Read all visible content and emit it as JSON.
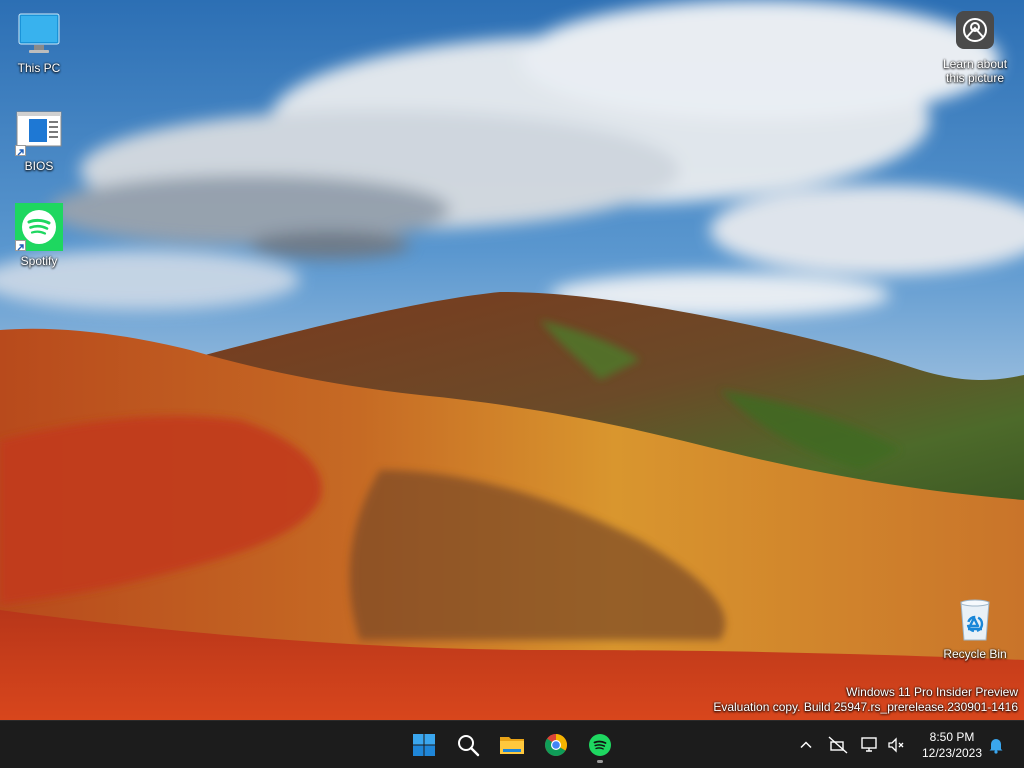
{
  "desktop": {
    "icons": [
      {
        "label": "This PC",
        "icon": "monitor-icon"
      },
      {
        "label": "BIOS",
        "icon": "bios-shortcut-icon"
      },
      {
        "label": "Spotify",
        "icon": "spotify-icon"
      },
      {
        "label": "Learn about\nthis picture",
        "icon": "camera-icon"
      },
      {
        "label": "Recycle Bin",
        "icon": "recycle-bin-icon"
      }
    ],
    "watermark": {
      "line1": "Windows 11 Pro Insider Preview",
      "line2": "Evaluation copy. Build 25947.rs_prerelease.230901-1416"
    }
  },
  "taskbar": {
    "apps": [
      {
        "name": "Start",
        "icon": "windows-start-icon"
      },
      {
        "name": "Search",
        "icon": "search-icon"
      },
      {
        "name": "File Explorer",
        "icon": "folder-icon"
      },
      {
        "name": "Google Chrome",
        "icon": "chrome-icon"
      },
      {
        "name": "Spotify",
        "icon": "spotify-icon"
      }
    ],
    "tray": {
      "icons": [
        "chevron-up-icon",
        "network-off-icon",
        "display-icon",
        "volume-muted-icon",
        "notification-bell-icon"
      ]
    },
    "clock": {
      "time": "8:50 PM",
      "date": "12/23/2023"
    }
  },
  "colors": {
    "taskbar": "#1c1c1c",
    "accent": "#0078d4",
    "spotify": "#1ed760"
  }
}
